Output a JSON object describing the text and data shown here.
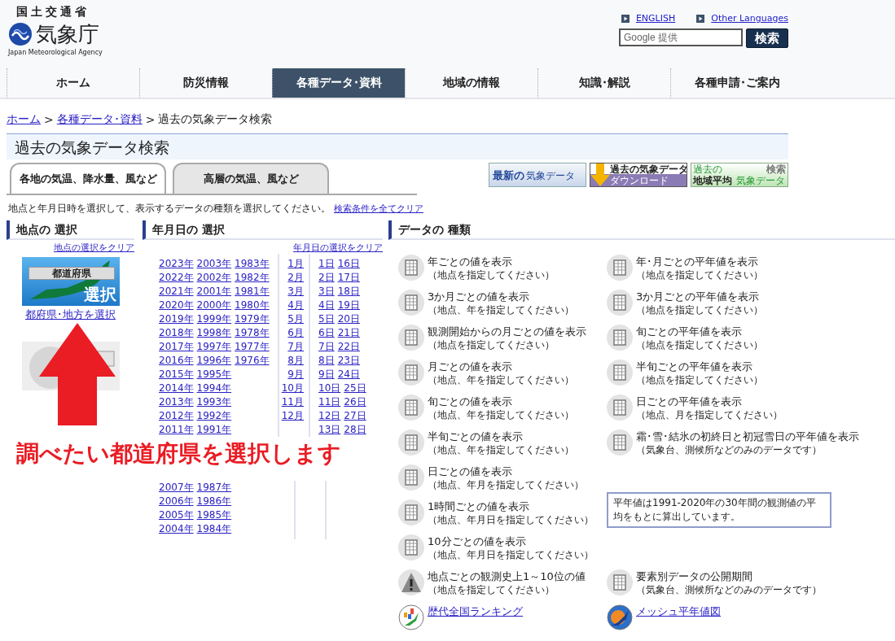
{
  "header": {
    "ministry": "国土交通省",
    "agency": "気象庁",
    "agency_en": "Japan Meteorological Agency",
    "lang_links": [
      "ENGLISH",
      "Other Languages"
    ],
    "search": {
      "placeholder": "Google 提供"
    },
    "search_button": "検索"
  },
  "nav": [
    {
      "label": "ホーム",
      "selected": false
    },
    {
      "label": "防災情報",
      "selected": false
    },
    {
      "label": "各種データ･資料",
      "selected": true
    },
    {
      "label": "地域の情報",
      "selected": false
    },
    {
      "label": "知識･解説",
      "selected": false
    },
    {
      "label": "各種申請･ご案内",
      "selected": false
    }
  ],
  "breadcrumb": {
    "separator": ">",
    "items": [
      {
        "label": "ホーム",
        "kind": "link"
      },
      {
        "label": "各種データ･資料",
        "kind": "link"
      },
      {
        "label": "過去の気象データ検索",
        "kind": "current"
      }
    ]
  },
  "page_title": "過去の気象データ検索",
  "tabs": [
    {
      "label": "各地の気温、降水量、風など",
      "selected": true
    },
    {
      "label": "高層の気温、風など",
      "selected": false
    }
  ],
  "banners": [
    {
      "kind": "latest",
      "texts": [
        "最新の",
        "気象データ"
      ]
    },
    {
      "kind": "download",
      "texts": [
        "過去の気象データ",
        "ダウンロード"
      ]
    },
    {
      "kind": "regional",
      "texts": [
        "過去の",
        "検索",
        "地域平均",
        "気象データ"
      ]
    }
  ],
  "instruction": {
    "text": "地点と年月日時を選択して、表示するデータの種類を選択してください。",
    "clear_link": "検索条件を全てクリア"
  },
  "station": {
    "heading": "地点の 選択",
    "clear_link": "地点の選択をクリア",
    "prefecture_button": [
      "都道府県",
      "選択"
    ],
    "prefecture_link": "都府県･地方を選択"
  },
  "date": {
    "heading": "年月日の 選択",
    "clear_link": "年月日の選択をクリア",
    "years_top": [
      [
        "2023年",
        "2003年",
        "1983年"
      ],
      [
        "2022年",
        "2002年",
        "1982年"
      ],
      [
        "2021年",
        "2001年",
        "1981年"
      ],
      [
        "2020年",
        "2000年",
        "1980年"
      ],
      [
        "2019年",
        "1999年",
        "1979年"
      ],
      [
        "2018年",
        "1998年",
        "1978年"
      ],
      [
        "2017年",
        "1997年",
        "1977年"
      ],
      [
        "2016年",
        "1996年",
        "1976年"
      ],
      [
        "2015年",
        "1995年"
      ],
      [
        "2014年",
        "1994年"
      ],
      [
        "2013年",
        "1993年"
      ],
      [
        "2012年",
        "1992年"
      ],
      [
        "2011年",
        "1991年"
      ]
    ],
    "months": [
      "1月",
      "2月",
      "3月",
      "4月",
      "5月",
      "6月",
      "7月",
      "8月",
      "9月",
      "10月",
      "11月",
      "12月"
    ],
    "days": [
      [
        "1日",
        "16日"
      ],
      [
        "2日",
        "17日"
      ],
      [
        "3日",
        "18日"
      ],
      [
        "4日",
        "19日"
      ],
      [
        "5日",
        "20日"
      ],
      [
        "6日",
        "21日"
      ],
      [
        "7日",
        "22日"
      ],
      [
        "8日",
        "23日"
      ],
      [
        "9日",
        "24日"
      ],
      [
        "10日",
        "25日"
      ],
      [
        "11日",
        "26日"
      ],
      [
        "12日",
        "27日"
      ],
      [
        "13日",
        "28日"
      ]
    ],
    "years_bottom": [
      [
        "2007年",
        "1987年"
      ],
      [
        "2006年",
        "1986年"
      ],
      [
        "2005年",
        "1985年"
      ],
      [
        "2004年",
        "1984年"
      ]
    ]
  },
  "annotation": "調べたい都道府県を選択します",
  "data_types": {
    "heading": "データの 種類",
    "left": [
      {
        "kind": "table",
        "title": "年ごとの値を表示",
        "note": "（地点を指定してください）"
      },
      {
        "kind": "table",
        "title": "3か月ごとの値を表示",
        "note": "（地点、年を指定してください）"
      },
      {
        "kind": "table",
        "title": "観測開始からの月ごとの値を表示",
        "note": "（地点を指定してください）"
      },
      {
        "kind": "table",
        "title": "月ごとの値を表示",
        "note": "（地点、年を指定してください）"
      },
      {
        "kind": "table",
        "title": "旬ごとの値を表示",
        "note": "（地点、年を指定してください）"
      },
      {
        "kind": "table",
        "title": "半旬ごとの値を表示",
        "note": "（地点、年を指定してください）"
      },
      {
        "kind": "table",
        "title": "日ごとの値を表示",
        "note": "（地点、年月を指定してください）"
      },
      {
        "kind": "table",
        "title": "1時間ごとの値を表示",
        "note": "（地点、年月日を指定してください）"
      },
      {
        "kind": "table",
        "title": "10分ごとの値を表示",
        "note": "（地点、年月日を指定してください）"
      },
      {
        "kind": "warning",
        "title": "地点ごとの観測史上1～10位の値",
        "note": "（地点を指定してください）"
      },
      {
        "kind": "ranking",
        "title": "歴代全国ランキング"
      }
    ],
    "right": [
      {
        "kind": "table",
        "title": "年･月ごとの平年値を表示",
        "note": "（地点を指定してください）"
      },
      {
        "kind": "table",
        "title": "3か月ごとの平年値を表示",
        "note": "（地点を指定してください）"
      },
      {
        "kind": "table",
        "title": "旬ごとの平年値を表示",
        "note": "（地点を指定してください）"
      },
      {
        "kind": "table",
        "title": "半旬ごとの平年値を表示",
        "note": "（地点を指定してください）"
      },
      {
        "kind": "table",
        "title": "日ごとの平年値を表示",
        "note": "（地点、月を指定してください）"
      },
      {
        "kind": "table",
        "title": "霜･雪･結氷の初終日と初冠雪日の平年値を表示",
        "note": "（気象台、測候所などのみのデータです）"
      },
      {
        "kind": "notice",
        "title": "平年値は1991-2020年の30年間の観測値の平均をもとに算出しています。"
      },
      {
        "kind": "table",
        "title": "要素別データの公開期間",
        "note": "（気象台、測候所などのみのデータです）"
      },
      {
        "kind": "mesh",
        "title": "メッシュ平年値図"
      }
    ]
  }
}
